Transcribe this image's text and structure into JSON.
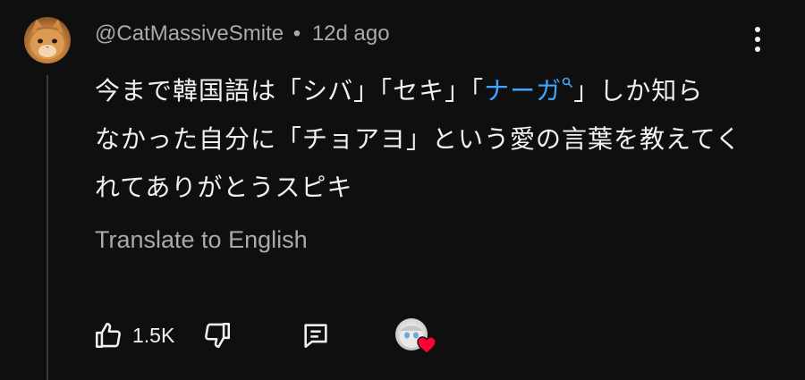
{
  "comment": {
    "author": "@CatMassiveSmite",
    "separator": "•",
    "time": "12d ago",
    "body": {
      "line1_pre": "今まで韓国語は「シバ」「セキ」「",
      "line1_link": "ナーガ",
      "line1_post": "」しか知ら",
      "line2": "なかった自分に「チョアヨ」という愛の言葉を教えてく",
      "line3": "れてありがとうスピキ"
    },
    "translate_label": "Translate to English",
    "like_count": "1.5K"
  },
  "icons": {
    "avatar": "cat-avatar",
    "menu": "more-vert-icon",
    "link_search": "search-icon",
    "like": "thumb-up-icon",
    "dislike": "thumb-down-icon",
    "reply": "reply-icon",
    "heart": "heart-icon"
  },
  "colors": {
    "background": "#0f0f0f",
    "text": "#f1f1f1",
    "secondary": "#aaaaaa",
    "link": "#3ea6ff",
    "heart": "#ff0033"
  }
}
